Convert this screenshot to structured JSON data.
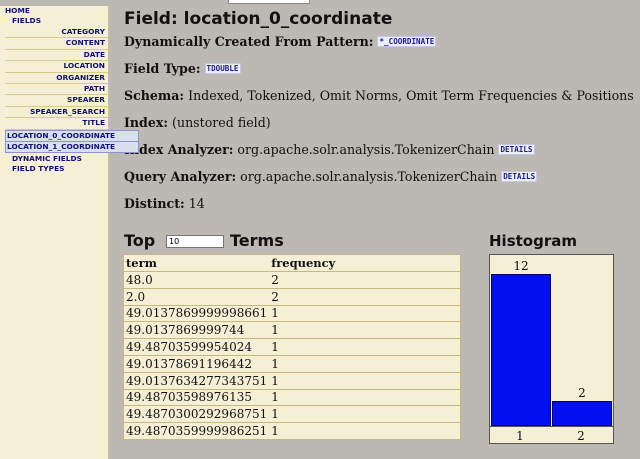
{
  "sidebar": {
    "home": "HOME",
    "fields": "FIELDS",
    "field_items": [
      {
        "label": "CATEGORY",
        "active": false
      },
      {
        "label": "CONTENT",
        "active": false
      },
      {
        "label": "DATE",
        "active": false
      },
      {
        "label": "LOCATION",
        "active": false
      },
      {
        "label": "ORGANIZER",
        "active": false
      },
      {
        "label": "PATH",
        "active": false
      },
      {
        "label": "SPEAKER",
        "active": false
      },
      {
        "label": "SPEAKER_SEARCH",
        "active": false
      },
      {
        "label": "TITLE",
        "active": false
      },
      {
        "label": "LOCATION_0_COORDINATE",
        "active": true
      },
      {
        "label": "LOCATION_1_COORDINATE",
        "active": true
      }
    ],
    "dynamic_fields": "DYNAMIC FIELDS",
    "field_types": "FIELD TYPES"
  },
  "main": {
    "title": "Field: location_0_coordinate",
    "pattern_label": "Dynamically Created From Pattern:",
    "pattern_value": "*_COORDINATE",
    "type_label": "Field Type:",
    "type_value": "TDOUBLE",
    "schema_label": "Schema:",
    "schema_value": "Indexed, Tokenized, Omit Norms, Omit Term Frequencies & Positions",
    "index_label": "Index:",
    "index_value": "(unstored field)",
    "index_analyzer_label": "Index Analyzer:",
    "index_analyzer_value": "org.apache.solr.analysis.TokenizerChain",
    "query_analyzer_label": "Query Analyzer:",
    "query_analyzer_value": "org.apache.solr.analysis.TokenizerChain",
    "details_label": "DETAILS",
    "distinct_label": "Distinct:",
    "distinct_value": "14"
  },
  "top_terms": {
    "heading_left": "Top",
    "heading_right": "Terms",
    "count_value": "10",
    "col_term": "term",
    "col_frequency": "frequency",
    "rows": [
      {
        "term": "48.0",
        "frequency": "2"
      },
      {
        "term": "2.0",
        "frequency": "2"
      },
      {
        "term": "49.0137869999998661",
        "frequency": "1"
      },
      {
        "term": "49.0137869999744",
        "frequency": "1"
      },
      {
        "term": "49.48703599954024",
        "frequency": "1"
      },
      {
        "term": "49.01378691196442",
        "frequency": "1"
      },
      {
        "term": "49.0137634277343751",
        "frequency": "1"
      },
      {
        "term": "49.48703598976135",
        "frequency": "1"
      },
      {
        "term": "49.4870300292968751",
        "frequency": "1"
      },
      {
        "term": "49.4870359999986251",
        "frequency": "1"
      }
    ]
  },
  "histogram": {
    "title": "Histogram",
    "colors": {
      "bar": "#0010ee"
    }
  },
  "chart_data": {
    "type": "bar",
    "categories": [
      "1",
      "2"
    ],
    "values": [
      12,
      2
    ],
    "ylim": [
      0,
      12
    ]
  }
}
